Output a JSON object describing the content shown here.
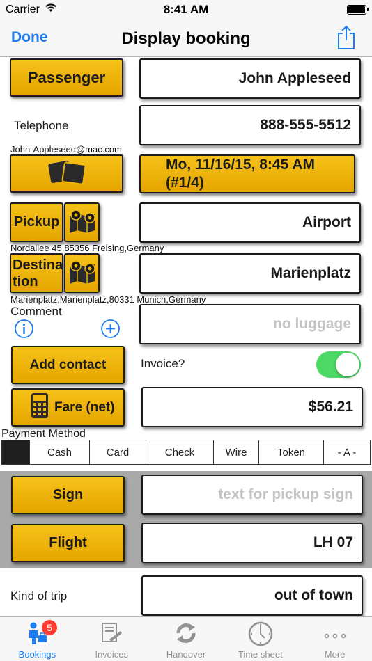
{
  "status_bar": {
    "carrier": "Carrier",
    "time": "8:41 AM"
  },
  "nav": {
    "done": "Done",
    "title": "Display booking",
    "share_icon": "share-icon"
  },
  "passenger": {
    "button": "Passenger",
    "value": "John Appleseed"
  },
  "telephone": {
    "label": "Telephone",
    "value": "888-555-5512",
    "email": "John-Appleseed@mac.com"
  },
  "date": {
    "button_icon": "cards-icon",
    "value_line1": "Mo, 11/16/15, 8:45 AM",
    "value_line2": "(#1/4)"
  },
  "pickup": {
    "button": "Pickup",
    "map_icon": "map-pin-icon",
    "value": "Airport",
    "address": "Nordallee 45,85356 Freising,Germany"
  },
  "destination": {
    "button_line1": "Destina",
    "button_line2": "tion",
    "map_icon": "map-pin-icon",
    "value": "Marienplatz",
    "address": "Marienplatz,Marienplatz,80331 Munich,Germany"
  },
  "comment": {
    "label": "Comment",
    "placeholder": "no luggage",
    "info_icon": "info-icon",
    "add_icon": "plus-circle-icon"
  },
  "contact": {
    "button": "Add contact",
    "invoice_label": "Invoice?",
    "invoice_on": true
  },
  "fare": {
    "button": "Fare (net)",
    "icon": "calculator-icon",
    "value": "$56.21"
  },
  "payment": {
    "label": "Payment Method",
    "options": [
      "",
      "Cash",
      "Card",
      "Check",
      "Wire",
      "Token",
      "- A -"
    ],
    "selected_index": 0
  },
  "sign": {
    "button": "Sign",
    "placeholder": "text for pickup sign"
  },
  "flight": {
    "button": "Flight",
    "value": "LH 07"
  },
  "trip": {
    "label": "Kind of trip",
    "value": "out of town"
  },
  "tabs": [
    {
      "label": "Bookings",
      "icon": "bookings-icon",
      "badge": "5",
      "active": true
    },
    {
      "label": "Invoices",
      "icon": "invoices-icon"
    },
    {
      "label": "Handover",
      "icon": "handover-icon"
    },
    {
      "label": "Time sheet",
      "icon": "clock-icon"
    },
    {
      "label": "More",
      "icon": "more-icon"
    }
  ],
  "colors": {
    "accent": "#1a7ef2",
    "button_yellow": "#f0b70a",
    "toggle_on": "#4cd964",
    "badge": "#ff3b30"
  }
}
